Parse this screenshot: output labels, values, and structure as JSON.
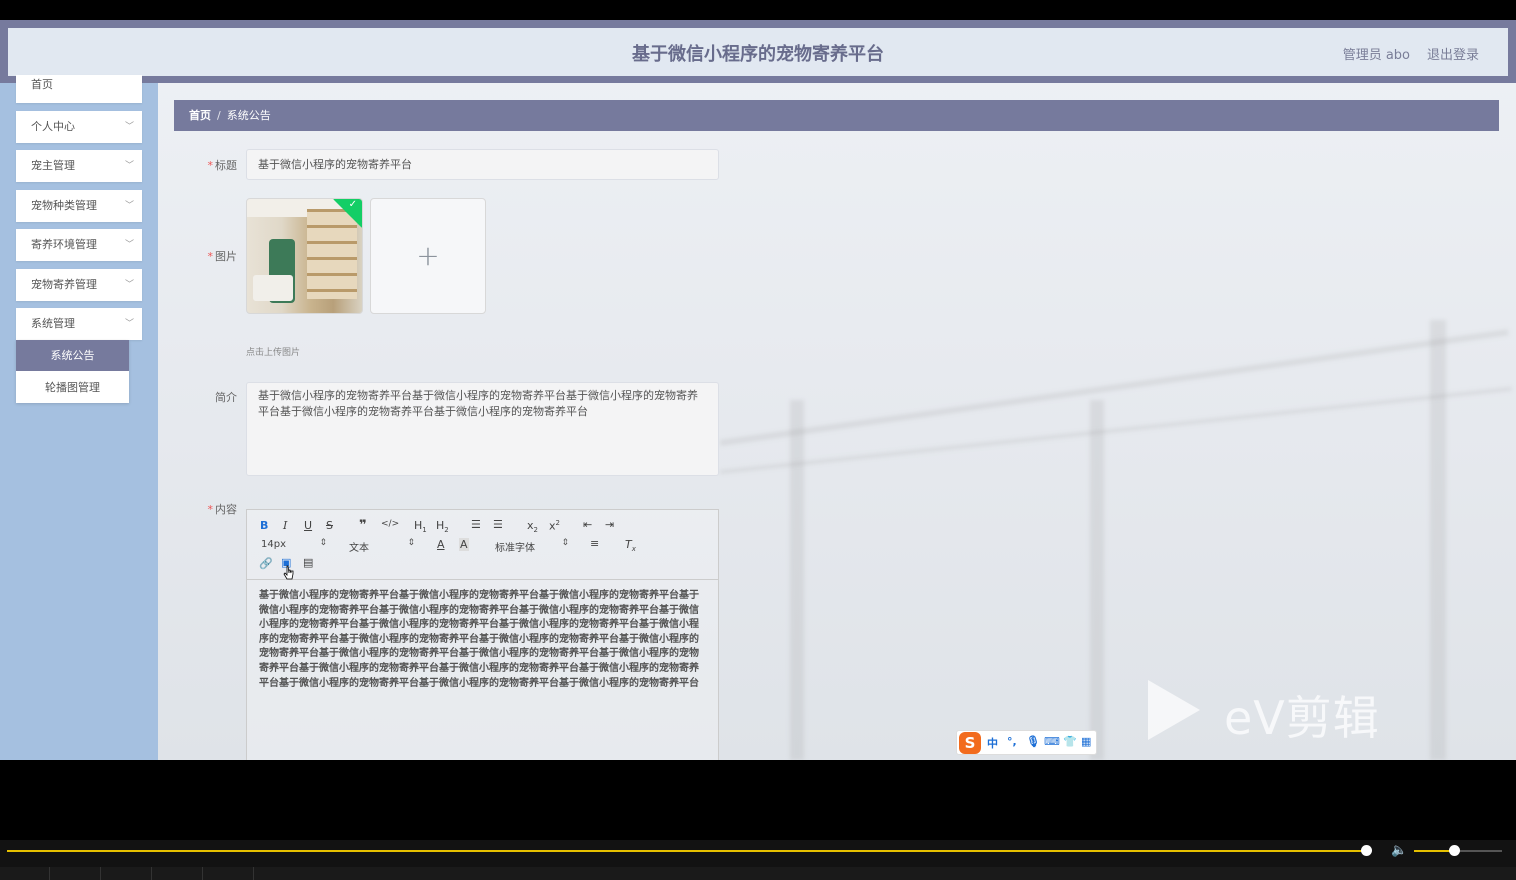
{
  "header": {
    "title": "基于微信小程序的宠物寄养平台",
    "admin": "管理员 abo",
    "logout": "退出登录"
  },
  "sidebar": {
    "items": [
      {
        "label": "首页"
      },
      {
        "label": "个人中心"
      },
      {
        "label": "宠主管理"
      },
      {
        "label": "宠物种类管理"
      },
      {
        "label": "寄养环境管理"
      },
      {
        "label": "宠物寄养管理"
      },
      {
        "label": "系统管理"
      }
    ],
    "submenu": [
      {
        "label": "系统公告",
        "active": true
      },
      {
        "label": "轮播图管理",
        "active": false
      }
    ]
  },
  "breadcrumb": {
    "home": "首页",
    "separator": "/",
    "current": "系统公告"
  },
  "form": {
    "title_label": "标题",
    "title_value": "基于微信小程序的宠物寄养平台",
    "image_label": "图片",
    "upload_tip": "点击上传图片",
    "intro_label": "简介",
    "intro_value": "基于微信小程序的宠物寄养平台基于微信小程序的宠物寄养平台基于微信小程序的宠物寄养平台基于微信小程序的宠物寄养平台基于微信小程序的宠物寄养平台",
    "content_label": "内容",
    "required_mark": "*"
  },
  "editor": {
    "font_size": "14px",
    "header_select": "文本",
    "font_family": "标准字体",
    "content": "基于微信小程序的宠物寄养平台基于微信小程序的宠物寄养平台基于微信小程序的宠物寄养平台基于微信小程序的宠物寄养平台基于微信小程序的宠物寄养平台基于微信小程序的宠物寄养平台基于微信小程序的宠物寄养平台基于微信小程序的宠物寄养平台基于微信小程序的宠物寄养平台基于微信小程序的宠物寄养平台基于微信小程序的宠物寄养平台基于微信小程序的宠物寄养平台基于微信小程序的宠物寄养平台基于微信小程序的宠物寄养平台基于微信小程序的宠物寄养平台基于微信小程序的宠物寄养平台基于微信小程序的宠物寄养平台基于微信小程序的宠物寄养平台基于微信小程序的宠物寄养平台基于微信小程序的宠物寄养平台基于微信小程序的宠物寄养平台基于微信小程序的宠物寄养平台"
  },
  "watermark": {
    "text": "eV剪辑"
  },
  "ime": {
    "logo": "S",
    "mode": "中",
    "punct": "°,"
  },
  "player": {
    "progress": 0.905,
    "volume": 0.45
  },
  "colors": {
    "header_bg": "#767a9d",
    "header_inner_bg": "#e1e8f1",
    "sidebar_bg": "#a5c0e0",
    "accent": "#767a9d",
    "progress_color": "#e5c000"
  }
}
